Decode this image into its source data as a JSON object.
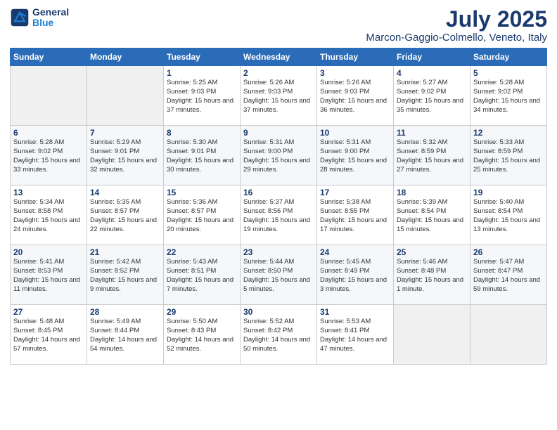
{
  "header": {
    "logo_line1": "General",
    "logo_line2": "Blue",
    "month": "July 2025",
    "location": "Marcon-Gaggio-Colmello, Veneto, Italy"
  },
  "weekdays": [
    "Sunday",
    "Monday",
    "Tuesday",
    "Wednesday",
    "Thursday",
    "Friday",
    "Saturday"
  ],
  "weeks": [
    [
      {
        "day": "",
        "info": ""
      },
      {
        "day": "",
        "info": ""
      },
      {
        "day": "1",
        "info": "Sunrise: 5:25 AM\nSunset: 9:03 PM\nDaylight: 15 hours\nand 37 minutes."
      },
      {
        "day": "2",
        "info": "Sunrise: 5:26 AM\nSunset: 9:03 PM\nDaylight: 15 hours\nand 37 minutes."
      },
      {
        "day": "3",
        "info": "Sunrise: 5:26 AM\nSunset: 9:03 PM\nDaylight: 15 hours\nand 36 minutes."
      },
      {
        "day": "4",
        "info": "Sunrise: 5:27 AM\nSunset: 9:02 PM\nDaylight: 15 hours\nand 35 minutes."
      },
      {
        "day": "5",
        "info": "Sunrise: 5:28 AM\nSunset: 9:02 PM\nDaylight: 15 hours\nand 34 minutes."
      }
    ],
    [
      {
        "day": "6",
        "info": "Sunrise: 5:28 AM\nSunset: 9:02 PM\nDaylight: 15 hours\nand 33 minutes."
      },
      {
        "day": "7",
        "info": "Sunrise: 5:29 AM\nSunset: 9:01 PM\nDaylight: 15 hours\nand 32 minutes."
      },
      {
        "day": "8",
        "info": "Sunrise: 5:30 AM\nSunset: 9:01 PM\nDaylight: 15 hours\nand 30 minutes."
      },
      {
        "day": "9",
        "info": "Sunrise: 5:31 AM\nSunset: 9:00 PM\nDaylight: 15 hours\nand 29 minutes."
      },
      {
        "day": "10",
        "info": "Sunrise: 5:31 AM\nSunset: 9:00 PM\nDaylight: 15 hours\nand 28 minutes."
      },
      {
        "day": "11",
        "info": "Sunrise: 5:32 AM\nSunset: 8:59 PM\nDaylight: 15 hours\nand 27 minutes."
      },
      {
        "day": "12",
        "info": "Sunrise: 5:33 AM\nSunset: 8:59 PM\nDaylight: 15 hours\nand 25 minutes."
      }
    ],
    [
      {
        "day": "13",
        "info": "Sunrise: 5:34 AM\nSunset: 8:58 PM\nDaylight: 15 hours\nand 24 minutes."
      },
      {
        "day": "14",
        "info": "Sunrise: 5:35 AM\nSunset: 8:57 PM\nDaylight: 15 hours\nand 22 minutes."
      },
      {
        "day": "15",
        "info": "Sunrise: 5:36 AM\nSunset: 8:57 PM\nDaylight: 15 hours\nand 20 minutes."
      },
      {
        "day": "16",
        "info": "Sunrise: 5:37 AM\nSunset: 8:56 PM\nDaylight: 15 hours\nand 19 minutes."
      },
      {
        "day": "17",
        "info": "Sunrise: 5:38 AM\nSunset: 8:55 PM\nDaylight: 15 hours\nand 17 minutes."
      },
      {
        "day": "18",
        "info": "Sunrise: 5:39 AM\nSunset: 8:54 PM\nDaylight: 15 hours\nand 15 minutes."
      },
      {
        "day": "19",
        "info": "Sunrise: 5:40 AM\nSunset: 8:54 PM\nDaylight: 15 hours\nand 13 minutes."
      }
    ],
    [
      {
        "day": "20",
        "info": "Sunrise: 5:41 AM\nSunset: 8:53 PM\nDaylight: 15 hours\nand 11 minutes."
      },
      {
        "day": "21",
        "info": "Sunrise: 5:42 AM\nSunset: 8:52 PM\nDaylight: 15 hours\nand 9 minutes."
      },
      {
        "day": "22",
        "info": "Sunrise: 5:43 AM\nSunset: 8:51 PM\nDaylight: 15 hours\nand 7 minutes."
      },
      {
        "day": "23",
        "info": "Sunrise: 5:44 AM\nSunset: 8:50 PM\nDaylight: 15 hours\nand 5 minutes."
      },
      {
        "day": "24",
        "info": "Sunrise: 5:45 AM\nSunset: 8:49 PM\nDaylight: 15 hours\nand 3 minutes."
      },
      {
        "day": "25",
        "info": "Sunrise: 5:46 AM\nSunset: 8:48 PM\nDaylight: 15 hours\nand 1 minute."
      },
      {
        "day": "26",
        "info": "Sunrise: 5:47 AM\nSunset: 8:47 PM\nDaylight: 14 hours\nand 59 minutes."
      }
    ],
    [
      {
        "day": "27",
        "info": "Sunrise: 5:48 AM\nSunset: 8:45 PM\nDaylight: 14 hours\nand 57 minutes."
      },
      {
        "day": "28",
        "info": "Sunrise: 5:49 AM\nSunset: 8:44 PM\nDaylight: 14 hours\nand 54 minutes."
      },
      {
        "day": "29",
        "info": "Sunrise: 5:50 AM\nSunset: 8:43 PM\nDaylight: 14 hours\nand 52 minutes."
      },
      {
        "day": "30",
        "info": "Sunrise: 5:52 AM\nSunset: 8:42 PM\nDaylight: 14 hours\nand 50 minutes."
      },
      {
        "day": "31",
        "info": "Sunrise: 5:53 AM\nSunset: 8:41 PM\nDaylight: 14 hours\nand 47 minutes."
      },
      {
        "day": "",
        "info": ""
      },
      {
        "day": "",
        "info": ""
      }
    ]
  ]
}
